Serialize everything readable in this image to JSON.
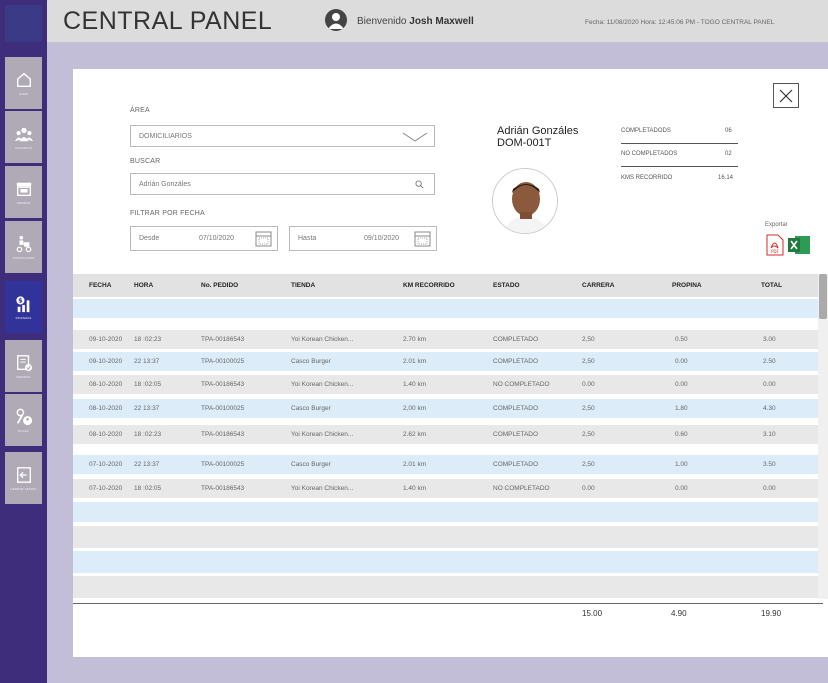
{
  "header": {
    "title": "CENTRAL PANEL",
    "welcome_prefix": "Bienvenido",
    "user_name": "Josh Maxwell",
    "dateline": "Fecha: 11/08/2020 Hora: 12:45:06 PM  - TOGO CENTRAL PANEL"
  },
  "sidebar": {
    "items": [
      {
        "label": "HOME",
        "icon": "home-icon"
      },
      {
        "label": "USUARIOS",
        "icon": "users-icon"
      },
      {
        "label": "TIENDAS",
        "icon": "store-icon"
      },
      {
        "label": "DOMICILIARIO",
        "icon": "delivery-icon"
      },
      {
        "label": "FINANZAS",
        "icon": "finance-icon"
      },
      {
        "label": "PEDIDOS",
        "icon": "orders-icon"
      },
      {
        "label": "ROLES",
        "icon": "roles-icon"
      },
      {
        "label": "CERRAR SESIÓN",
        "icon": "logout-icon"
      }
    ],
    "active": "FINANZAS"
  },
  "filters": {
    "area_label": "ÁREA",
    "area_value": "DOMICILIARIOS",
    "search_label": "BUSCAR",
    "search_value": "Adrián Gonzáles",
    "date_filter_label": "FILTRAR POR FECHA",
    "from_label": "Desde",
    "from_value": "07/10/2020",
    "to_label": "Hasta",
    "to_value": "09/10/2020"
  },
  "employee": {
    "name": "Adrián Gonzáles",
    "code": "DOM-001T",
    "stats": [
      {
        "label": "COMPLETADODS",
        "value": "06"
      },
      {
        "label": "NO COMPLETADOS",
        "value": "02"
      },
      {
        "label": "KMS RECORRIDO",
        "value": "16.14"
      }
    ]
  },
  "export": {
    "label": "Exportar",
    "pdf_text": "PDF"
  },
  "table": {
    "columns": [
      "FECHA",
      "HORA",
      "No. PEDIDO",
      "TIENDA",
      "KM RECORRIDO",
      "ESTADO",
      "CARRERA",
      "PROPINA",
      "TOTAL"
    ],
    "rows": [
      [
        "09-10-2020",
        "18 :02:23",
        "TPA-00186543",
        "Yoi Korean Chicken...",
        "2.70 km",
        "COMPLETADO",
        "2,50",
        "0.50",
        "3.00"
      ],
      [
        "09-10-2020",
        "22 13:37",
        "TPA-00100025",
        "Casco Burger",
        "2.01 km",
        "COMPLETADO",
        "2,50",
        "0.00",
        "2.50"
      ],
      [
        "08-10-2020",
        "18 :02:05",
        "TPA-00186543",
        "Yoi Korean Chicken...",
        "1.40 km",
        "NO COMPLETADO",
        "0.00",
        "0.00",
        "0.00"
      ],
      [
        "08-10-2020",
        "22 13:37",
        "TPA-00100025",
        "Casco Burger",
        "2,00 km",
        "COMPLETADO",
        "2,50",
        "1.80",
        "4.30"
      ],
      [
        "08-10-2020",
        "18 :02:23",
        "TPA-00186543",
        "Yoi Korean Chicken...",
        "2.62 km",
        "COMPLETADO",
        "2,50",
        "0.60",
        "3.10"
      ],
      [
        "07-10-2020",
        "22 13:37",
        "TPA-00100025",
        "Casco Burger",
        "2.01 km",
        "COMPLETADO",
        "2,50",
        "1.00",
        "3.50"
      ],
      [
        "07-10-2020",
        "18 :02:05",
        "TPA-00186543",
        "Yoi Korean Chicken...",
        "1.40 km",
        "NO COMPLETADO",
        "0.00",
        "0.00",
        "0.00"
      ]
    ],
    "totals": {
      "carrera": "15.00",
      "propina": "4.90",
      "total": "19.90"
    }
  },
  "colors": {
    "sidebar_bg": "#3e2d7a",
    "active_item": "#32339a",
    "row_blue": "#dcecf9",
    "row_gray": "#e8e8e8",
    "excel_green": "#1f7a3c",
    "pdf_red": "#d62b2b"
  }
}
